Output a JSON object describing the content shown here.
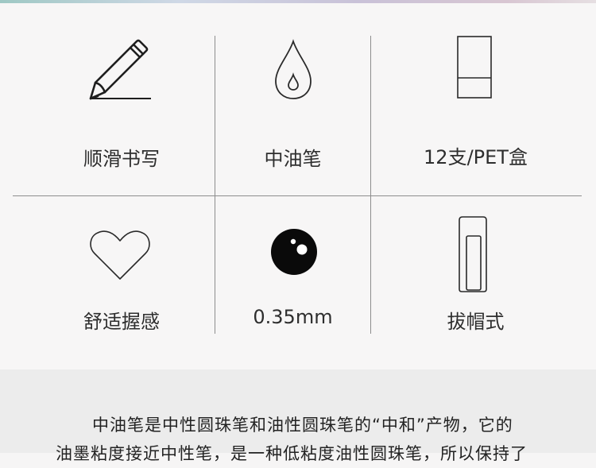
{
  "features": [
    {
      "label": "顺滑书写",
      "icon": "pencil-icon"
    },
    {
      "label": "中油笔",
      "icon": "ink-drop-icon"
    },
    {
      "label": "12支/PET盒",
      "icon": "box-icon"
    },
    {
      "label": "舒适握感",
      "icon": "heart-icon"
    },
    {
      "label": "0.35mm",
      "icon": "ball-tip-icon"
    },
    {
      "label": "拔帽式",
      "icon": "pen-cap-icon"
    }
  ],
  "description": {
    "line1": "中油笔是中性圆珠笔和油性圆珠笔的“中和”产物，它的",
    "line2": "油墨粘度接近中性笔，是一种低粘度油性圆珠笔，所以保持了"
  },
  "colors": {
    "line": "#8d8d8d",
    "text": "#2e2e2e",
    "background": "#f7f6f6",
    "lower_panel": "#ececec"
  }
}
